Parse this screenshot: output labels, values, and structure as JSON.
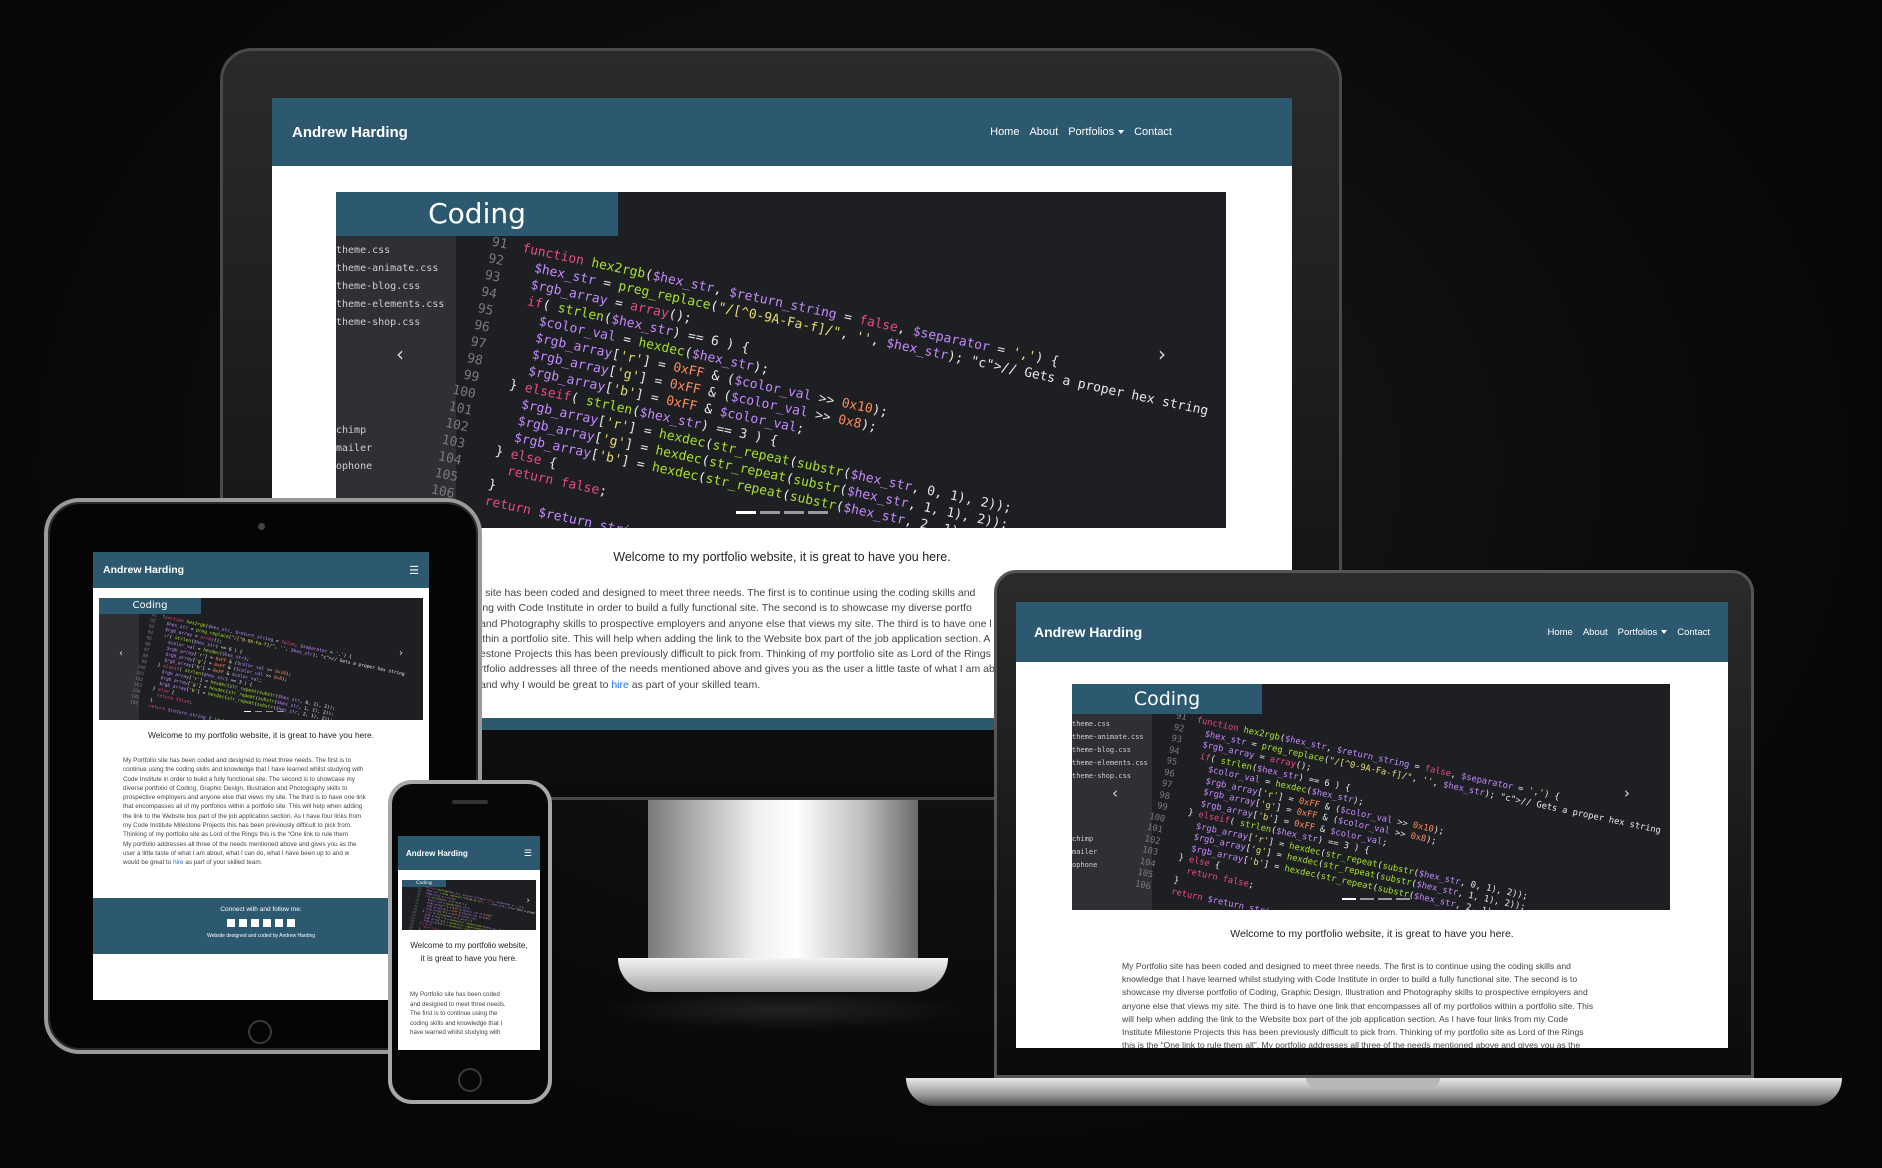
{
  "site": {
    "brand": "Andrew Harding",
    "nav": [
      "Home",
      "About",
      "Portfolios",
      "Contact"
    ],
    "hero_label": "Coding",
    "welcome": "Welcome to my portfolio website, it is great to have you here.",
    "intro_full": "My Portfolio site has been coded and designed to meet three needs. The first is to continue using the coding skills and knowledge that I have learned whilst studying with Code Institute in order to build a fully functional site. The second is to showcase my diverse portfolio of Coding, Graphic Design, Illustration and Photography skills to prospective employers and anyone else that views my site. The third is to have one link that encompasses all of my portfolios within a portfolio site. This will help when adding the link to the Website box part of the job application section. As I have four links from my Code Institute Milestone Projects this has been previously difficult to pick from. Thinking of my portfolio site as Lord of the Rings this is the “One link to rule them all”. My portfolio addresses all three of the needs mentioned above and gives you as the user a little taste of what I am about, what I can do, what I have been up to and why I would be great to",
    "hire_link": "hire",
    "intro_tail": "as part of your skilled team.",
    "imac_intro_lines": [
      "l site has been coded and designed to meet three needs. The first is to continue using the coding skills and",
      "ing with Code Institute in order to build a fully functional site. The second is to showcase my diverse portfo",
      "and Photography skills to prospective employers and anyone else that views my site. The third is to have one l",
      "ithin a portfolio site. This will help when adding the link to the Website box part of the job application section. A",
      "estone Projects this has been previously difficult to pick from. Thinking of my portfolio site as Lord of the Rings",
      "rtfolio addresses all three of the needs mentioned above and gives you as the user a little taste of what I am ab",
      "and why I would be great to"
    ],
    "mac_intro_lines": [
      "My Portfolio site has been coded and designed to meet three needs. The first is to continue using the coding skills and",
      "knowledge that I have learned whilst studying with Code Institute in order to build a fully functional site. The second is to",
      "showcase my diverse portfolio of Coding, Graphic Design, Illustration and Photography skills to prospective employers and",
      "anyone else that views my site. The third is to have one link that encompasses all of my portfolios within a portfolio site. This",
      "will help when adding the link to the Website box part of the job application section. As I have four links from my Code",
      "Institute Milestone Projects this has been previously difficult to pick from. Thinking of my portfolio site as Lord of the Rings",
      "this is the “One link to rule them all”. My portfolio addresses all three of the needs mentioned above and gives you as the"
    ],
    "ipad_intro_lines": [
      "My Portfolio site has been coded and designed to meet three needs. The first is to",
      "continue using the coding skills and knowledge that I have learned whilst studying with",
      "Code Institute in order to build a fully functional site. The second is to showcase my",
      "diverse portfolio of Coding, Graphic Design, Illustration and Photography skills to",
      "prospective employers and anyone else that views my site. The third is to have one link",
      "that encompasses all of my portfolios within a portfolio site. This will help when adding",
      "the link to the Website box part of the job application section. As I have four links from",
      "my Code Institute Milestone Projects this has been previously difficult to pick from.",
      "Thinking of my portfolio site as Lord of the Rings this is the “One link to rule them",
      "My portfolio addresses all three of the needs mentioned above and gives you as the",
      "user a little taste of what I am about, what I can do, what I have been up to and w",
      "would be great to"
    ],
    "phone_intro_lines": [
      "My Portfolio site has been coded",
      "and designed to meet three needs.",
      "The first is to continue using the",
      "coding skills and knowledge that I",
      "have learned whilst studying with"
    ],
    "footer_connect": "Connect with and follow me:",
    "footer_credit": "Website designed and coded by Andrew Harding",
    "social_icons": [
      "facebook-icon",
      "linkedin-icon",
      "instagram-icon",
      "twitter-icon",
      "behance-icon",
      "email-icon"
    ]
  },
  "code_sidebar_files": [
    "theme.css",
    "theme-animate.css",
    "theme-blog.css",
    "theme-elements.css",
    "theme-shop.css",
    "chimp",
    "mailer",
    "ophone"
  ],
  "code_lines": [
    {
      "n": "91",
      "t": "function hex2rgb($hex_str, $return_string = false, $separator = ',') {"
    },
    {
      "n": "92",
      "t": "  $hex_str = preg_replace(\"/[^0-9A-Fa-f]/\", '', $hex_str); // Gets a proper hex string"
    },
    {
      "n": "93",
      "t": "  $rgb_array = array();"
    },
    {
      "n": "94",
      "t": "  if( strlen($hex_str) == 6 ) {"
    },
    {
      "n": "95",
      "t": "    $color_val = hexdec($hex_str);"
    },
    {
      "n": "96",
      "t": "    $rgb_array['r'] = 0xFF & ($color_val >> 0x10);"
    },
    {
      "n": "97",
      "t": "    $rgb_array['g'] = 0xFF & ($color_val >> 0x8);"
    },
    {
      "n": "98",
      "t": "    $rgb_array['b'] = 0xFF & $color_val;"
    },
    {
      "n": "99",
      "t": "  } elseif( strlen($hex_str) == 3 ) {"
    },
    {
      "n": "100",
      "t": "    $rgb_array['r'] = hexdec(str_repeat(substr($hex_str, 0, 1), 2));"
    },
    {
      "n": "101",
      "t": "    $rgb_array['g'] = hexdec(str_repeat(substr($hex_str, 1, 1), 2));"
    },
    {
      "n": "102",
      "t": "    $rgb_array['b'] = hexdec(str_repeat(substr($hex_str, 2, 1), 2));"
    },
    {
      "n": "103",
      "t": "  } else {"
    },
    {
      "n": "104",
      "t": "    return false;"
    },
    {
      "n": "105",
      "t": "  }"
    },
    {
      "n": "106",
      "t": "  return $return_string ? implode($separator, $rgb_array) : $rgb_array;"
    }
  ],
  "colors": {
    "nav": "#2c5870",
    "link": "#1a73e8",
    "code_bg": "#1e1f22"
  }
}
